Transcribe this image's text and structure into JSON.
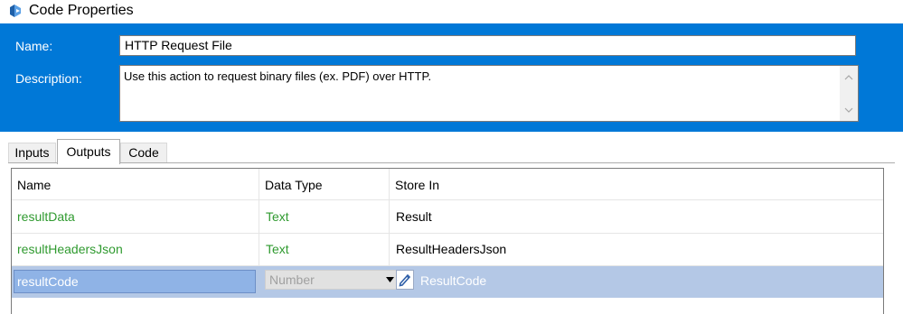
{
  "window": {
    "title": "Code Properties",
    "icon": "code-properties-icon"
  },
  "header": {
    "name_label": "Name:",
    "name_value": "HTTP Request File",
    "description_label": "Description:",
    "description_value": "Use this action to request binary files (ex. PDF) over HTTP.",
    "accent_color": "#0078d7"
  },
  "tabs": [
    {
      "label": "Inputs",
      "active": false
    },
    {
      "label": "Outputs",
      "active": true
    },
    {
      "label": "Code",
      "active": false
    }
  ],
  "grid": {
    "columns": [
      "Name",
      "Data Type",
      "Store In"
    ],
    "rows": [
      {
        "name": "resultData",
        "type": "Text",
        "store": "Result"
      },
      {
        "name": "resultHeadersJson",
        "type": "Text",
        "store": "ResultHeadersJson"
      }
    ],
    "edit_row": {
      "name": "resultCode",
      "type": "Number",
      "store": "ResultCode"
    },
    "name_color": "#2f9a2f",
    "selection_color": "#b4c8e6"
  }
}
